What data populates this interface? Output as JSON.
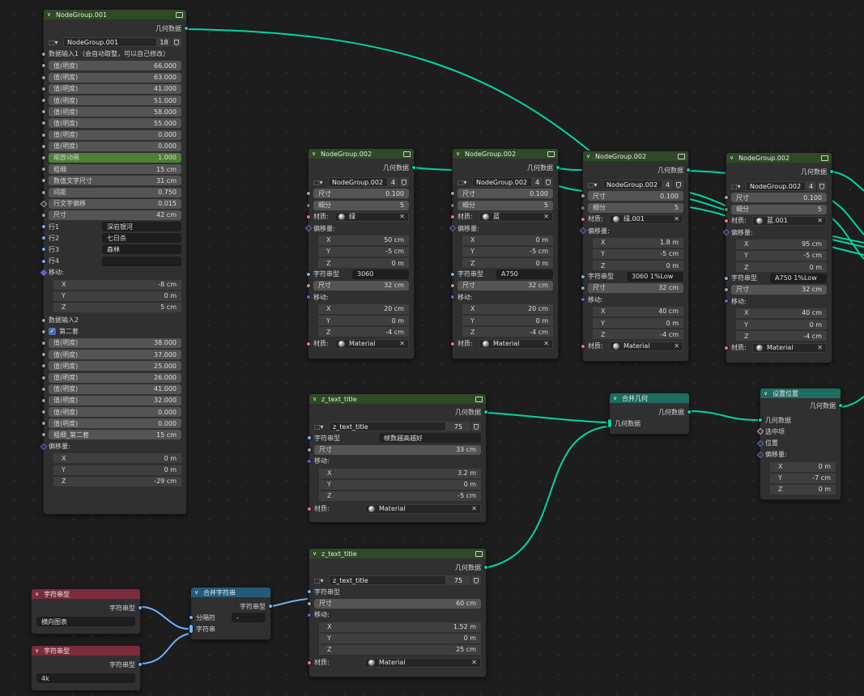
{
  "n1": {
    "title": "NodeGroup.001",
    "out": "几何数据",
    "group_name": "NodeGroup.001",
    "users": "18",
    "input1": "数据输入1（会自动取整，可以自己修改）",
    "values1": [
      {
        "label": "值(明度)",
        "value": "66.000"
      },
      {
        "label": "值(明度)",
        "value": "63.000"
      },
      {
        "label": "值(明度)",
        "value": "41.000"
      },
      {
        "label": "值(明度)",
        "value": "51.000"
      },
      {
        "label": "值(明度)",
        "value": "58.000"
      },
      {
        "label": "值(明度)",
        "value": "55.000"
      },
      {
        "label": "值(明度)",
        "value": "0.000"
      },
      {
        "label": "值(明度)",
        "value": "0.000"
      }
    ],
    "anim": {
      "label": "缩放动画",
      "value": "1.000"
    },
    "params": [
      {
        "label": "粗细",
        "value": "15 cm"
      },
      {
        "label": "数值文字尺寸",
        "value": "31 cm"
      },
      {
        "label": "间距",
        "value": "0.750"
      },
      {
        "label": "行文字偏移",
        "value": "0.015"
      },
      {
        "label": "尺寸",
        "value": "42 cm"
      }
    ],
    "rows": [
      {
        "label": "行1",
        "value": "深岩银河"
      },
      {
        "label": "行2",
        "value": "七日杀"
      },
      {
        "label": "行3",
        "value": "森林"
      },
      {
        "label": "行4",
        "value": ""
      }
    ],
    "move_label": "移动:",
    "move": [
      {
        "axis": "X",
        "value": "-8 cm"
      },
      {
        "axis": "Y",
        "value": "0 m"
      },
      {
        "axis": "Z",
        "value": "5 cm"
      }
    ],
    "input2": "数据输入2",
    "second_set": "第二套",
    "values2": [
      {
        "label": "值(明度)",
        "value": "38.000"
      },
      {
        "label": "值(明度)",
        "value": "37.000"
      },
      {
        "label": "值(明度)",
        "value": "25.000"
      },
      {
        "label": "值(明度)",
        "value": "26.000"
      },
      {
        "label": "值(明度)",
        "value": "41.000"
      },
      {
        "label": "值(明度)",
        "value": "32.000"
      },
      {
        "label": "值(明度)",
        "value": "0.000"
      },
      {
        "label": "值(明度)",
        "value": "0.000"
      }
    ],
    "thick2": {
      "label": "粗细_第二套",
      "value": "15 cm"
    },
    "offset_label": "偏移量:",
    "offset": [
      {
        "axis": "X",
        "value": "0 m"
      },
      {
        "axis": "Y",
        "value": "0 m"
      },
      {
        "axis": "Z",
        "value": "-29 cm"
      }
    ]
  },
  "ng": [
    {
      "title": "NodeGroup.002",
      "out": "几何数据",
      "group_name": "NodeGroup.002",
      "users": "4",
      "size": {
        "label": "尺寸",
        "value": "0.100"
      },
      "subdiv": {
        "label": "细分",
        "value": "5"
      },
      "mat_label": "材质:",
      "mat1": "绿",
      "offset_label": "偏移量:",
      "offset": [
        {
          "axis": "X",
          "value": "50 cm"
        },
        {
          "axis": "Y",
          "value": "-5 cm"
        },
        {
          "axis": "Z",
          "value": "0 m"
        }
      ],
      "str_label": "字符串型",
      "str": "3060",
      "size2": {
        "label": "尺寸",
        "value": "32 cm"
      },
      "move_label": "移动:",
      "move": [
        {
          "axis": "X",
          "value": "20 cm"
        },
        {
          "axis": "Y",
          "value": "0 m"
        },
        {
          "axis": "Z",
          "value": "-4 cm"
        }
      ],
      "mat2": "Material"
    },
    {
      "title": "NodeGroup.002",
      "out": "几何数据",
      "group_name": "NodeGroup.002",
      "users": "4",
      "size": {
        "label": "尺寸",
        "value": "0.100"
      },
      "subdiv": {
        "label": "细分",
        "value": "5"
      },
      "mat_label": "材质:",
      "mat1": "蓝",
      "offset_label": "偏移量:",
      "offset": [
        {
          "axis": "X",
          "value": "0 m"
        },
        {
          "axis": "Y",
          "value": "-5 cm"
        },
        {
          "axis": "Z",
          "value": "0 m"
        }
      ],
      "str_label": "字符串型",
      "str": "A750",
      "size2": {
        "label": "尺寸",
        "value": "32 cm"
      },
      "move_label": "移动:",
      "move": [
        {
          "axis": "X",
          "value": "20 cm"
        },
        {
          "axis": "Y",
          "value": "0 m"
        },
        {
          "axis": "Z",
          "value": "-4 cm"
        }
      ],
      "mat2": "Material"
    },
    {
      "title": "NodeGroup.002",
      "out": "几何数据",
      "group_name": "NodeGroup.002",
      "users": "4",
      "size": {
        "label": "尺寸",
        "value": "0.100"
      },
      "subdiv": {
        "label": "细分",
        "value": "5"
      },
      "mat_label": "材质:",
      "mat1": "绿.001",
      "offset_label": "偏移量:",
      "offset": [
        {
          "axis": "X",
          "value": "1.8 m"
        },
        {
          "axis": "Y",
          "value": "-5 cm"
        },
        {
          "axis": "Z",
          "value": "0 m"
        }
      ],
      "str_label": "字符串型",
      "str": "3060 1%Low",
      "size2": {
        "label": "尺寸",
        "value": "32 cm"
      },
      "move_label": "移动:",
      "move": [
        {
          "axis": "X",
          "value": "40 cm"
        },
        {
          "axis": "Y",
          "value": "0 m"
        },
        {
          "axis": "Z",
          "value": "-4 cm"
        }
      ],
      "mat2": "Material"
    },
    {
      "title": "NodeGroup.002",
      "out": "几何数据",
      "group_name": "NodeGroup.002",
      "users": "4",
      "size": {
        "label": "尺寸",
        "value": "0.100"
      },
      "subdiv": {
        "label": "细分",
        "value": "5"
      },
      "mat_label": "材质:",
      "mat1": "蓝.001",
      "offset_label": "偏移量:",
      "offset": [
        {
          "axis": "X",
          "value": "95 cm"
        },
        {
          "axis": "Y",
          "value": "-5 cm"
        },
        {
          "axis": "Z",
          "value": "0 m"
        }
      ],
      "str_label": "字符串型",
      "str": "A750 1%Low",
      "size2": {
        "label": "尺寸",
        "value": "32 cm"
      },
      "move_label": "移动:",
      "move": [
        {
          "axis": "X",
          "value": "40 cm"
        },
        {
          "axis": "Y",
          "value": "0 m"
        },
        {
          "axis": "Z",
          "value": "-4 cm"
        }
      ],
      "mat2": "Material"
    }
  ],
  "zt1": {
    "title": "z_text_title",
    "out": "几何数据",
    "group_name": "z_text_title",
    "users": "75",
    "str_label": "字符串型",
    "str": "帧数越高越好",
    "size": {
      "label": "尺寸",
      "value": "33 cm"
    },
    "move_label": "移动:",
    "move": [
      {
        "axis": "X",
        "value": "3.2 m"
      },
      {
        "axis": "Y",
        "value": "0 m"
      },
      {
        "axis": "Z",
        "value": "-5 cm"
      }
    ],
    "mat_label": "材质:",
    "mat": "Material"
  },
  "zt2": {
    "title": "z_text_title",
    "out": "几何数据",
    "group_name": "z_text_title",
    "users": "75",
    "str_label": "字符串型",
    "size": {
      "label": "尺寸",
      "value": "60 cm"
    },
    "move_label": "移动:",
    "move": [
      {
        "axis": "X",
        "value": "1.52 m"
      },
      {
        "axis": "Y",
        "value": "0 m"
      },
      {
        "axis": "Z",
        "value": "25 cm"
      }
    ],
    "mat_label": "材质:",
    "mat": "Material"
  },
  "join": {
    "title": "合并几何",
    "out": "几何数据",
    "in": "几何数据"
  },
  "setpos": {
    "title": "设置位置",
    "out": "几何数据",
    "in_geo": "几何数据",
    "selection": "选中项",
    "position": "位置",
    "offset_label": "偏移量:",
    "offset": [
      {
        "axis": "X",
        "value": "0 m"
      },
      {
        "axis": "Y",
        "value": "-7 cm"
      },
      {
        "axis": "Z",
        "value": "0 m"
      }
    ]
  },
  "str1": {
    "title": "字符串型",
    "out": "字符串型",
    "value": "横向图表"
  },
  "str2": {
    "title": "字符串型",
    "out": "字符串型",
    "value": "4k"
  },
  "strjoin": {
    "title": "合并字符串",
    "out": "字符串型",
    "delim_label": "分隔符",
    "delim": "-",
    "strings": "字符串"
  },
  "colors": {
    "geometry": "#00d6a3",
    "string": "#70b2ff",
    "float": "#a1a1a1",
    "vector": "#6363c7",
    "material": "#eb7582",
    "int": "#598c5c"
  }
}
